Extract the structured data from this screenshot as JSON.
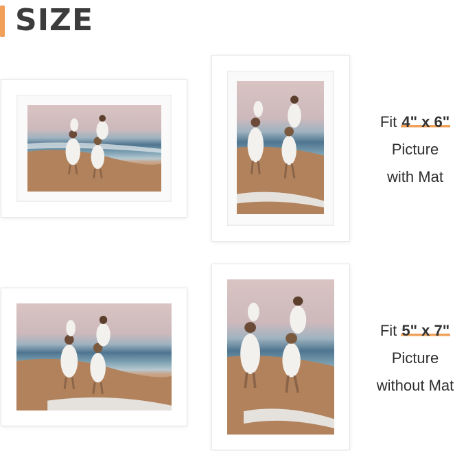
{
  "header": {
    "title": "SIZE",
    "accent_color": "#f0a058"
  },
  "section_top": {
    "fit_word": "Fit",
    "size": "4\" x 6\"",
    "line2": "Picture",
    "line3": "with Mat"
  },
  "section_bottom": {
    "fit_word": "Fit",
    "size": "5\" x 7\"",
    "line2": "Picture",
    "line3": "without Mat"
  },
  "photo_description_icon": "beach-family-photo",
  "frame_color": "#ffffff"
}
